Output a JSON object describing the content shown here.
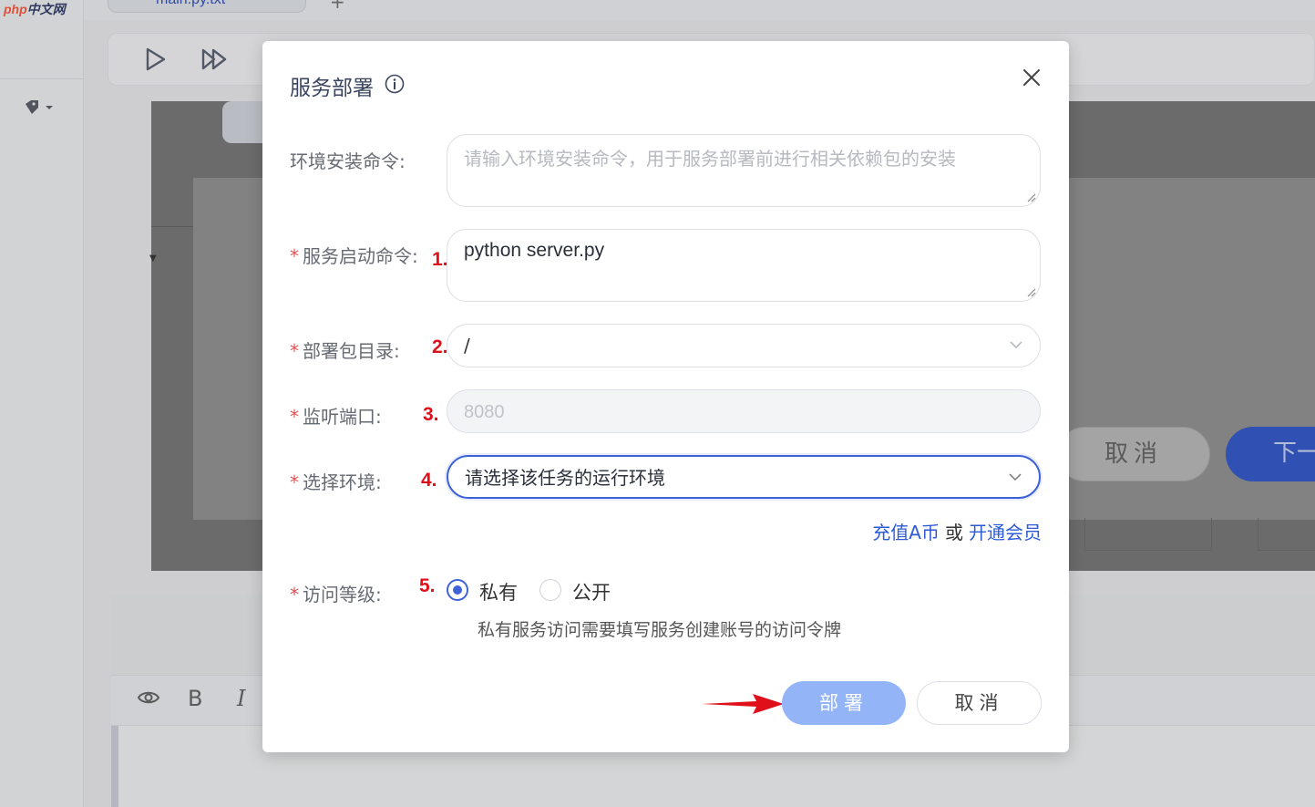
{
  "background": {
    "logo_php": "php",
    "logo_text": "中文网",
    "file_tab": "main.py.txt",
    "bg_cancel_label": "取消",
    "bg_next_label": "下一"
  },
  "dialog": {
    "title": "服务部署",
    "fields": {
      "env_install": {
        "label": "环境安装命令:",
        "placeholder": "请输入环境安装命令，用于服务部署前进行相关依赖包的安装",
        "value": ""
      },
      "start_cmd": {
        "required_mark": "*",
        "label": "服务启动命令:",
        "value": "python server.py",
        "step": "1."
      },
      "package_dir": {
        "required_mark": "*",
        "label": "部署包目录:",
        "value": "/",
        "step": "2."
      },
      "port": {
        "required_mark": "*",
        "label": "监听端口:",
        "value": "8080",
        "step": "3."
      },
      "environment": {
        "required_mark": "*",
        "label": "选择环境:",
        "placeholder": "请选择该任务的运行环境",
        "step": "4."
      },
      "access_level": {
        "required_mark": "*",
        "label": "访问等级:",
        "step": "5.",
        "options": [
          "私有",
          "公开"
        ],
        "selected": "私有",
        "hint": "私有服务访问需要填写服务创建账号的访问令牌"
      }
    },
    "links": {
      "recharge": "充值A币",
      "or": "或",
      "membership": "开通会员"
    },
    "buttons": {
      "deploy": "部署",
      "cancel": "取消"
    },
    "colors": {
      "primary": "#3e63d8",
      "deploy_button": "#93b4f7",
      "required": "#e05252",
      "annotation": "#e0101a"
    }
  }
}
